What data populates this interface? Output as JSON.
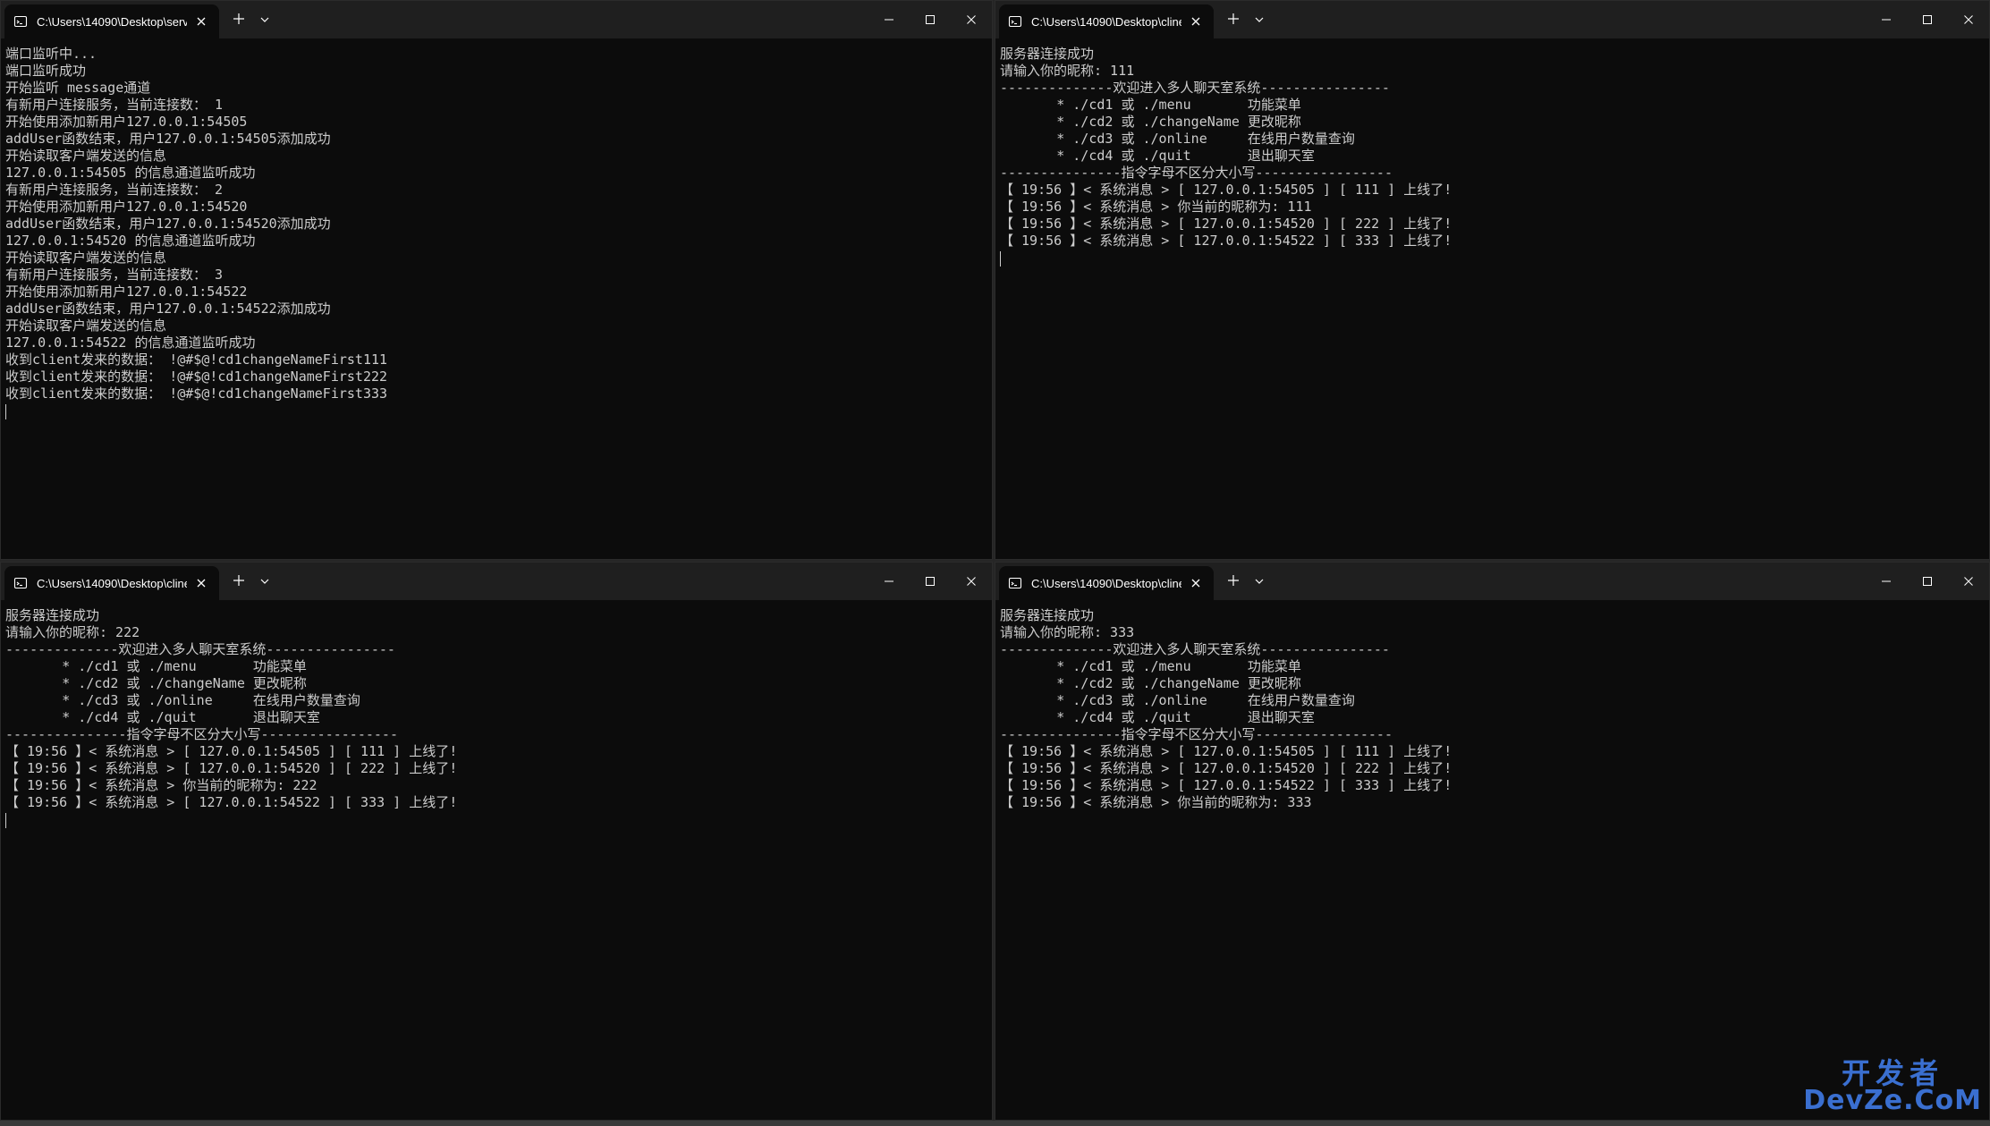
{
  "windows": {
    "server": {
      "tab_title": "C:\\Users\\14090\\Desktop\\serve",
      "lines": [
        "端口监听中...",
        "端口监听成功",
        "开始监听 message通道",
        "有新用户连接服务，当前连接数： 1",
        "开始使用添加新用户127.0.0.1:54505",
        "addUser函数结束，用户127.0.0.1:54505添加成功",
        "开始读取客户端发送的信息",
        "127.0.0.1:54505 的信息通道监听成功",
        "有新用户连接服务，当前连接数： 2",
        "开始使用添加新用户127.0.0.1:54520",
        "addUser函数结束，用户127.0.0.1:54520添加成功",
        "127.0.0.1:54520 的信息通道监听成功",
        "开始读取客户端发送的信息",
        "有新用户连接服务，当前连接数： 3",
        "开始使用添加新用户127.0.0.1:54522",
        "addUser函数结束，用户127.0.0.1:54522添加成功",
        "开始读取客户端发送的信息",
        "127.0.0.1:54522 的信息通道监听成功",
        "收到client发来的数据： !@#$@!cd1changeNameFirst111",
        "收到client发来的数据： !@#$@!cd1changeNameFirst222",
        "收到client发来的数据： !@#$@!cd1changeNameFirst333"
      ]
    },
    "client1": {
      "tab_title": "C:\\Users\\14090\\Desktop\\cline",
      "lines": [
        "服务器连接成功",
        "请输入你的昵称: 111",
        "--------------欢迎进入多人聊天室系统----------------",
        "       * ./cd1 或 ./menu       功能菜单",
        "       * ./cd2 或 ./changeName 更改昵称",
        "       * ./cd3 或 ./online     在线用户数量查询",
        "       * ./cd4 或 ./quit       退出聊天室",
        "---------------指令字母不区分大小写-----------------",
        "【 19:56 】< 系统消息 > [ 127.0.0.1:54505 ] [ 111 ] 上线了!",
        "【 19:56 】< 系统消息 > 你当前的昵称为: 111",
        "【 19:56 】< 系统消息 > [ 127.0.0.1:54520 ] [ 222 ] 上线了!",
        "【 19:56 】< 系统消息 > [ 127.0.0.1:54522 ] [ 333 ] 上线了!"
      ]
    },
    "client2": {
      "tab_title": "C:\\Users\\14090\\Desktop\\cline",
      "lines": [
        "服务器连接成功",
        "请输入你的昵称: 222",
        "--------------欢迎进入多人聊天室系统----------------",
        "       * ./cd1 或 ./menu       功能菜单",
        "       * ./cd2 或 ./changeName 更改昵称",
        "       * ./cd3 或 ./online     在线用户数量查询",
        "       * ./cd4 或 ./quit       退出聊天室",
        "---------------指令字母不区分大小写-----------------",
        "【 19:56 】< 系统消息 > [ 127.0.0.1:54505 ] [ 111 ] 上线了!",
        "【 19:56 】< 系统消息 > [ 127.0.0.1:54520 ] [ 222 ] 上线了!",
        "【 19:56 】< 系统消息 > 你当前的昵称为: 222",
        "【 19:56 】< 系统消息 > [ 127.0.0.1:54522 ] [ 333 ] 上线了!"
      ]
    },
    "client3": {
      "tab_title": "C:\\Users\\14090\\Desktop\\cline",
      "lines": [
        "服务器连接成功",
        "请输入你的昵称: 333",
        "--------------欢迎进入多人聊天室系统----------------",
        "       * ./cd1 或 ./menu       功能菜单",
        "       * ./cd2 或 ./changeName 更改昵称",
        "       * ./cd3 或 ./online     在线用户数量查询",
        "       * ./cd4 或 ./quit       退出聊天室",
        "---------------指令字母不区分大小写-----------------",
        "【 19:56 】< 系统消息 > [ 127.0.0.1:54505 ] [ 111 ] 上线了!",
        "【 19:56 】< 系统消息 > [ 127.0.0.1:54520 ] [ 222 ] 上线了!",
        "【 19:56 】< 系统消息 > [ 127.0.0.1:54522 ] [ 333 ] 上线了!",
        "【 19:56 】< 系统消息 > 你当前的昵称为: 333"
      ]
    }
  },
  "watermark": {
    "cn": "开发者",
    "en": "DevZe.CoM"
  },
  "colors": {
    "console_bg": "#0c0c0c",
    "console_text": "#cccccc",
    "titlebar_bg": "#1f1f1f",
    "watermark": "#3a6fd0"
  },
  "icons": [
    "terminal-icon",
    "close-icon",
    "plus-icon",
    "chevron-down-icon",
    "minimize-icon",
    "maximize-icon",
    "window-close-icon"
  ]
}
